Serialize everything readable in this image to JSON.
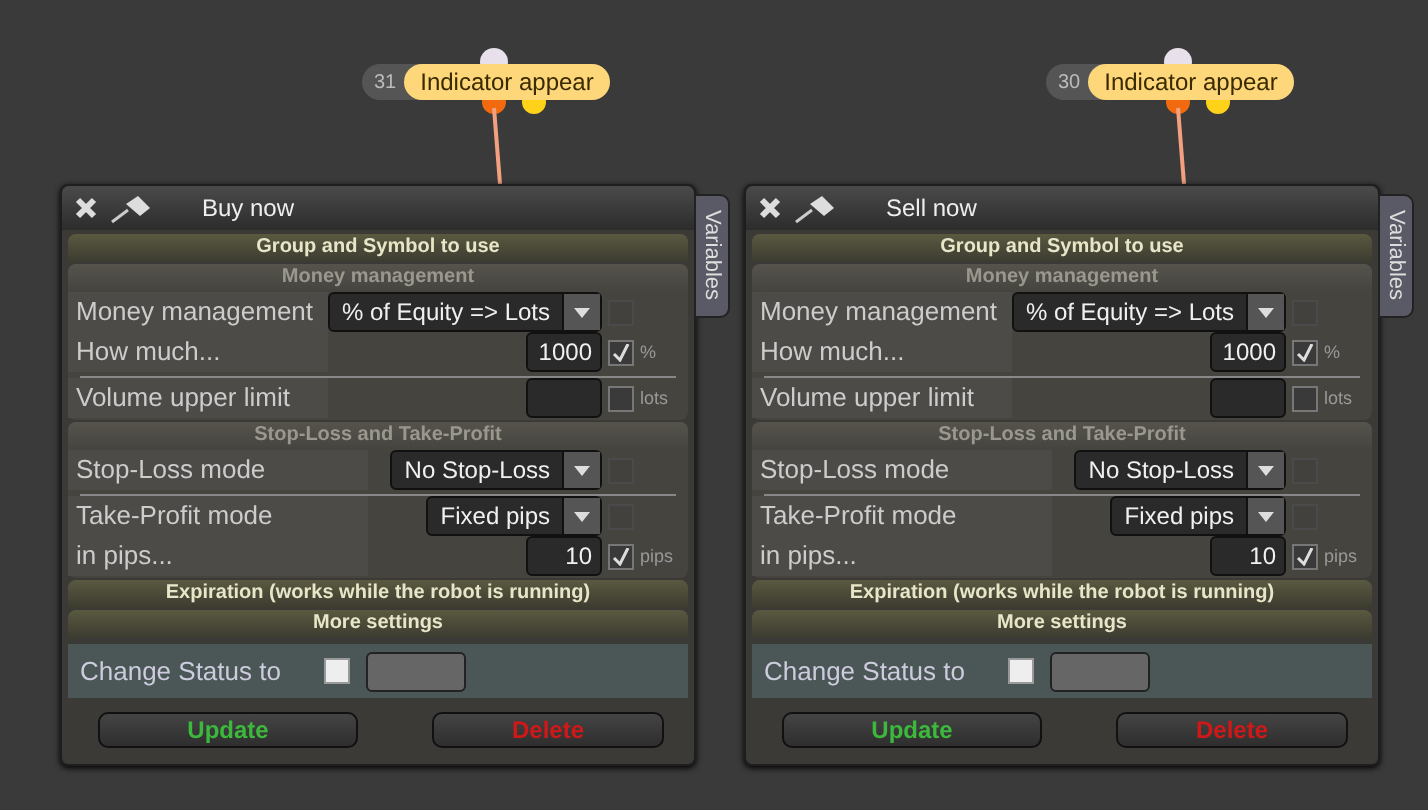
{
  "nodes": [
    {
      "badge": "31",
      "label": "Indicator appear",
      "window": {
        "title": "Buy now",
        "side_tab": "Variables"
      },
      "sections": [
        {
          "kind": "header",
          "title": "Group and Symbol to use"
        },
        {
          "kind": "panel",
          "title": "Money management",
          "groups": [
            [
              {
                "label": "Money management",
                "kind": "dropdown",
                "value": "% of Equity => Lots",
                "checkbox": {
                  "checked": false,
                  "disabled": true
                }
              },
              {
                "label": "How much...",
                "kind": "number",
                "value": "1000",
                "checkbox": {
                  "checked": true,
                  "disabled": false,
                  "unit": "%"
                }
              }
            ],
            [
              {
                "label": "Volume upper limit",
                "kind": "number",
                "checkbox": {
                  "checked": false,
                  "disabled": false,
                  "unit": "lots"
                }
              }
            ]
          ]
        },
        {
          "kind": "panel",
          "title": "Stop-Loss and Take-Profit",
          "groups": [
            [
              {
                "label": "Stop-Loss mode",
                "kind": "dropdown",
                "value": "No Stop-Loss",
                "checkbox": {
                  "checked": false,
                  "disabled": true
                }
              }
            ],
            [
              {
                "label": "Take-Profit mode",
                "kind": "dropdown",
                "value": "Fixed pips",
                "checkbox": {
                  "checked": false,
                  "disabled": true
                }
              },
              {
                "label": "in pips...",
                "kind": "number",
                "value": "10",
                "checkbox": {
                  "checked": true,
                  "disabled": false,
                  "unit": "pips"
                }
              }
            ]
          ]
        },
        {
          "kind": "header",
          "title": "Expiration (works while the robot is running)"
        },
        {
          "kind": "header",
          "title": "More settings"
        }
      ],
      "status": {
        "label": "Change Status to",
        "checked": false
      },
      "buttons": [
        {
          "label": "Update",
          "kind": "confirm"
        },
        {
          "label": "Delete",
          "kind": "danger"
        }
      ]
    },
    {
      "badge": "30",
      "label": "Indicator appear",
      "window": {
        "title": "Sell now",
        "side_tab": "Variables"
      },
      "sections": [
        {
          "kind": "header",
          "title": "Group and Symbol to use"
        },
        {
          "kind": "panel",
          "title": "Money management",
          "groups": [
            [
              {
                "label": "Money management",
                "kind": "dropdown",
                "value": "% of Equity => Lots",
                "checkbox": {
                  "checked": false,
                  "disabled": true
                }
              },
              {
                "label": "How much...",
                "kind": "number",
                "value": "1000",
                "checkbox": {
                  "checked": true,
                  "disabled": false,
                  "unit": "%"
                }
              }
            ],
            [
              {
                "label": "Volume upper limit",
                "kind": "number",
                "checkbox": {
                  "checked": false,
                  "disabled": false,
                  "unit": "lots"
                }
              }
            ]
          ]
        },
        {
          "kind": "panel",
          "title": "Stop-Loss and Take-Profit",
          "groups": [
            [
              {
                "label": "Stop-Loss mode",
                "kind": "dropdown",
                "value": "No Stop-Loss",
                "checkbox": {
                  "checked": false,
                  "disabled": true
                }
              }
            ],
            [
              {
                "label": "Take-Profit mode",
                "kind": "dropdown",
                "value": "Fixed pips",
                "checkbox": {
                  "checked": false,
                  "disabled": true
                }
              },
              {
                "label": "in pips...",
                "kind": "number",
                "value": "10",
                "checkbox": {
                  "checked": true,
                  "disabled": false,
                  "unit": "pips"
                }
              }
            ]
          ]
        },
        {
          "kind": "header",
          "title": "Expiration (works while the robot is running)"
        },
        {
          "kind": "header",
          "title": "More settings"
        }
      ],
      "status": {
        "label": "Change Status to",
        "checked": false
      },
      "buttons": [
        {
          "label": "Update",
          "kind": "confirm"
        },
        {
          "label": "Delete",
          "kind": "danger"
        }
      ]
    }
  ]
}
